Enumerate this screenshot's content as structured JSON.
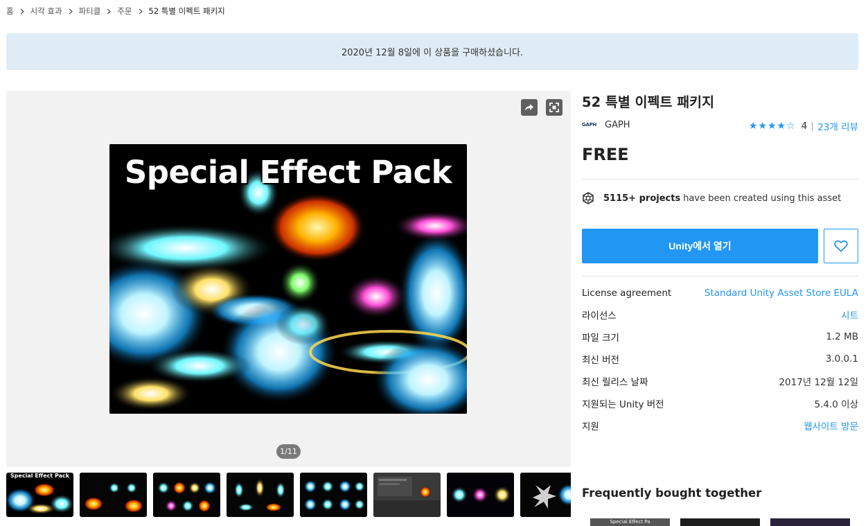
{
  "breadcrumb": [
    "홈",
    "시각 효과",
    "파티클",
    "주문",
    "52 특별 이펙트 패키지"
  ],
  "banner": {
    "text": "2020년 12월 8일에 이 상품을 구매하셨습니다."
  },
  "gallery": {
    "share_icon": "share-arrow-icon",
    "fullscreen_icon": "fullscreen-icon",
    "main_image_text": "Special Effect Pack",
    "counter": "1/11",
    "thumbnail_first_label": "Special Effect Pack",
    "thumbnail_count": 8
  },
  "product": {
    "title": "52 특별 이펙트 패키지",
    "publisher_logo": "GAPH",
    "publisher": "GAPH",
    "stars": "★★★★☆",
    "rating": "4",
    "reviews": "23개 리뷰",
    "price": "FREE",
    "projects_count": "5115+ projects",
    "projects_text": "have been created using this asset",
    "open_button": "Unity에서 열기",
    "wishlist_icon": "heart-icon",
    "accent_color": "#2196f3"
  },
  "info": [
    {
      "key": "License agreement",
      "value": "Standard Unity Asset Store EULA",
      "link": true
    },
    {
      "key": "라이선스",
      "value": "시트",
      "link": true
    },
    {
      "key": "파일 크기",
      "value": "1.2 MB",
      "link": false
    },
    {
      "key": "최신 버전",
      "value": "3.0.0.1",
      "link": false
    },
    {
      "key": "최신 릴리스 날짜",
      "value": "2017년 12월 12일",
      "link": false
    },
    {
      "key": "지원되는 Unity 버전",
      "value": "5.4.0 이상",
      "link": false
    },
    {
      "key": "지원",
      "value": "웹사이트 방문",
      "link": true
    }
  ],
  "fbt": {
    "title": "Frequently bought together",
    "card1_caption": "Special Effect Pa"
  }
}
